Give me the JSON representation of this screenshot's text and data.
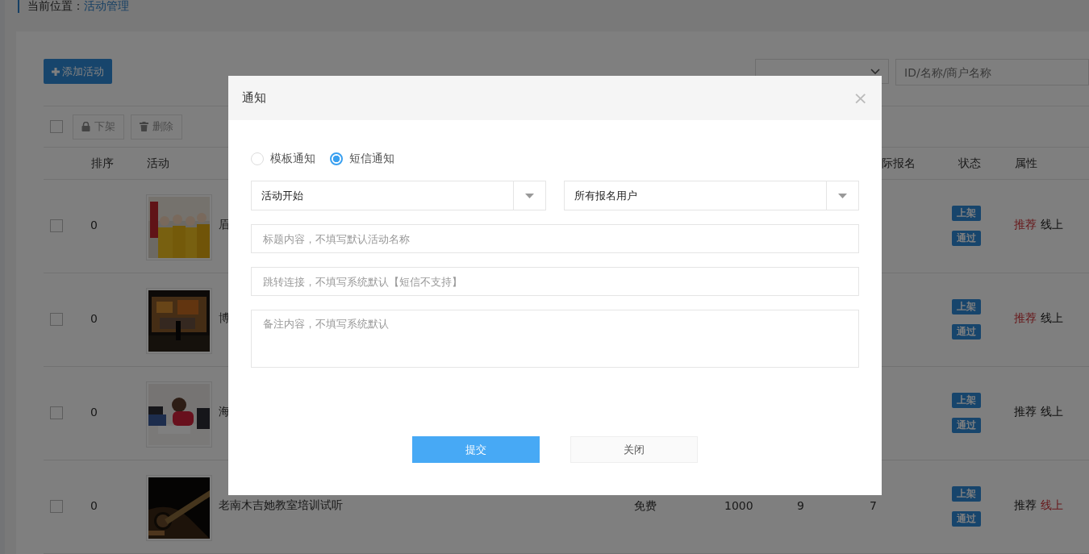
{
  "breadcrumb": {
    "label": "当前位置：",
    "current": "活动管理"
  },
  "toolbar": {
    "add_button": "添加活动",
    "search": {
      "placeholder": "ID/名称/商户名称"
    }
  },
  "bulk_actions": {
    "select_all": {
      "checked": false
    },
    "buttons": [
      {
        "label": "下架",
        "kind": "offline"
      },
      {
        "label": "删除",
        "kind": "delete"
      }
    ]
  },
  "table": {
    "columns": [
      {
        "label": "排序"
      },
      {
        "label": "活动"
      },
      {
        "label": "际报名"
      },
      {
        "label": "状态"
      },
      {
        "label": "属性"
      }
    ],
    "rows": [
      {
        "checked": false,
        "order": "0",
        "title": "眉",
        "cells": [],
        "status": [
          "上架",
          "通过"
        ],
        "recommended": {
          "label": "推荐",
          "on": true
        },
        "online": {
          "label": "线上",
          "on": false
        }
      },
      {
        "checked": false,
        "order": "0",
        "title": "博",
        "cells": [],
        "status": [
          "上架",
          "通过"
        ],
        "recommended": {
          "label": "推荐",
          "on": true
        },
        "online": {
          "label": "线上",
          "on": false
        }
      },
      {
        "checked": false,
        "order": "0",
        "title": "海",
        "cells": [],
        "status": [
          "上架",
          "通过"
        ],
        "recommended": {
          "label": "推荐",
          "on": false
        },
        "online": {
          "label": "线上",
          "on": false
        }
      },
      {
        "checked": false,
        "order": "0",
        "title": "老南木吉她教室培训试听",
        "cells": [
          "免费",
          "1000",
          "9",
          "7"
        ],
        "status": [
          "上架",
          "通过"
        ],
        "recommended": {
          "label": "推荐",
          "on": false
        },
        "online": {
          "label": "线上",
          "on": true
        }
      }
    ]
  },
  "dialog": {
    "title": "通知",
    "close": "×",
    "notice_types": [
      {
        "label": "模板通知",
        "selected": false
      },
      {
        "label": "短信通知",
        "selected": true
      }
    ],
    "selects": [
      {
        "value": "活动开始"
      },
      {
        "value": "所有报名用户"
      }
    ],
    "fields": [
      {
        "kind": "input",
        "placeholder": "标题内容，不填写默认活动名称"
      },
      {
        "kind": "input",
        "placeholder": "跳转连接，不填写系统默认【短信不支持】"
      },
      {
        "kind": "textarea",
        "placeholder": "备注内容，不填写系统默认"
      }
    ],
    "buttons": [
      {
        "label": "提交",
        "kind": "primary"
      },
      {
        "label": "关闭",
        "kind": "default"
      }
    ]
  }
}
